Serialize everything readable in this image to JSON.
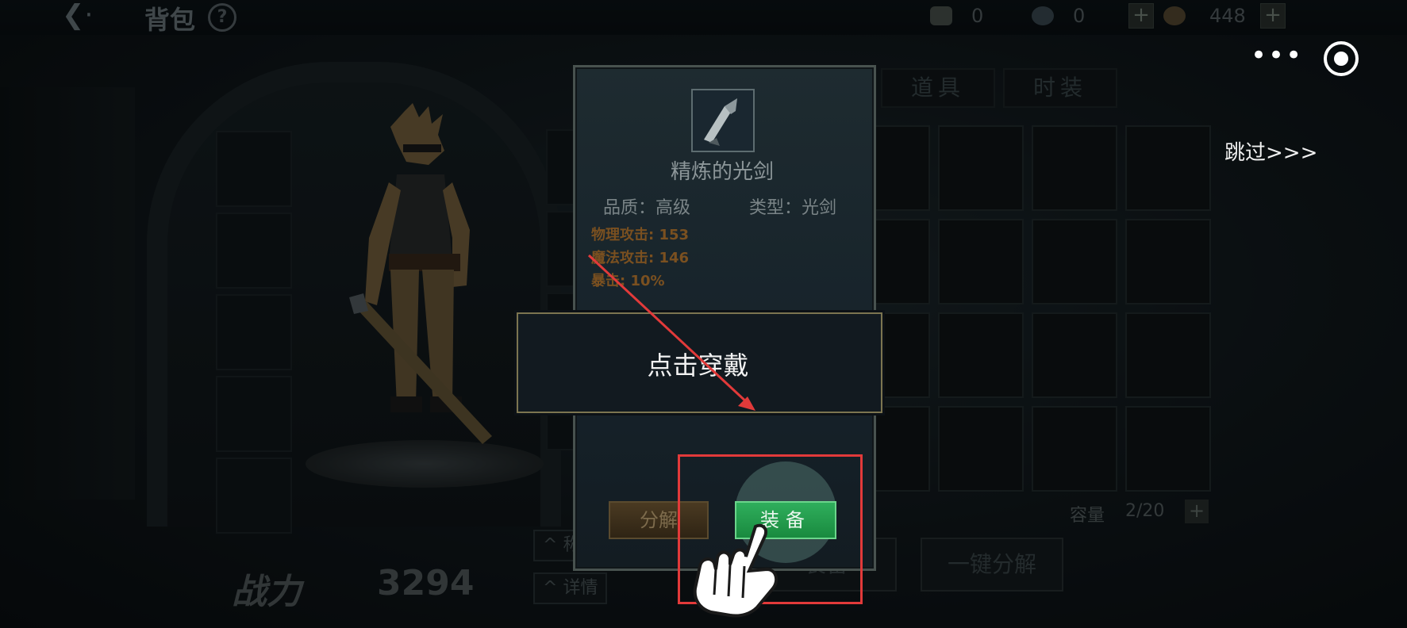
{
  "header": {
    "title": "背包",
    "currencies": [
      {
        "icon": "ticket-icon",
        "value": "0"
      },
      {
        "icon": "gem-icon",
        "value": "0"
      },
      {
        "icon": "coin-icon",
        "value": "448"
      }
    ]
  },
  "character": {
    "power_label": "战力",
    "power_value": "3294",
    "side_buttons": [
      "称",
      "详情"
    ]
  },
  "inventory": {
    "tabs": [
      "道具",
      "时装"
    ],
    "capacity_label": "容量",
    "capacity_value": "2/20",
    "buttons": [
      "装备",
      "一键分解"
    ]
  },
  "item_popup": {
    "name": "精炼的光剑",
    "quality": "品质：高级",
    "type": "类型：光剑",
    "stats": [
      "物理攻击: 153",
      "魔法攻击: 146",
      "暴击: 10%"
    ],
    "decompose_label": "分解",
    "equip_label": "装备"
  },
  "tutorial": {
    "tip": "点击穿戴",
    "skip": "跳过>>>"
  },
  "colors": {
    "equip_green": "#23a04f",
    "highlight_red": "#e23a3a",
    "stat_orange": "#7a5020"
  }
}
